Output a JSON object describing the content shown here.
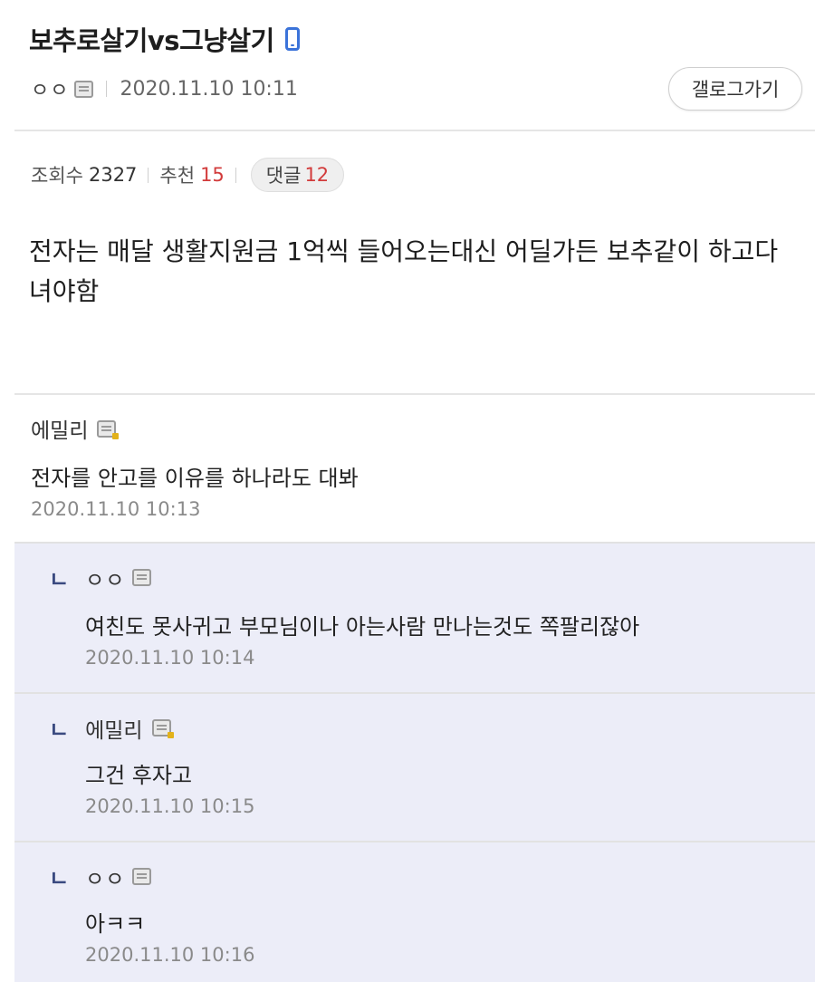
{
  "post": {
    "title": "보추로살기vs그냥살기",
    "author": "ㅇㅇ",
    "datetime": "2020.11.10 10:11",
    "gallog_button": "갤로그가기",
    "stats": {
      "views_label": "조회수",
      "views": "2327",
      "recommend_label": "추천",
      "recommend": "15",
      "comments_label": "댓글",
      "comments": "12"
    },
    "body": "전자는 매달 생활지원금 1억씩 들어오는대신 어딜가든 보추같이 하고다녀야함"
  },
  "comments": [
    {
      "author": "에밀리",
      "text": "전자를 안고를 이유를 하나라도 대봐",
      "datetime": "2020.11.10 10:13",
      "reply": false
    },
    {
      "author": "ㅇㅇ",
      "text": "여친도 못사귀고 부모님이나 아는사람 만나는것도 쪽팔리잖아",
      "datetime": "2020.11.10 10:14",
      "reply": true,
      "reply_mark": "ㄴ"
    },
    {
      "author": "에밀리",
      "text": "그건 후자고",
      "datetime": "2020.11.10 10:15",
      "reply": true,
      "reply_mark": "ㄴ"
    },
    {
      "author": "ㅇㅇ",
      "text": "아ㅋㅋ",
      "datetime": "2020.11.10 10:16",
      "reply": true,
      "reply_mark": "ㄴ"
    }
  ],
  "colors": {
    "accent_red": "#d23b3b",
    "reply_bg": "#ecedf8",
    "phone_icon": "#3b73d9"
  },
  "icons": {
    "device": "mobile-phone-icon",
    "memo": "memo-icon",
    "memo_gold": "fixed-nick-memo-icon"
  }
}
